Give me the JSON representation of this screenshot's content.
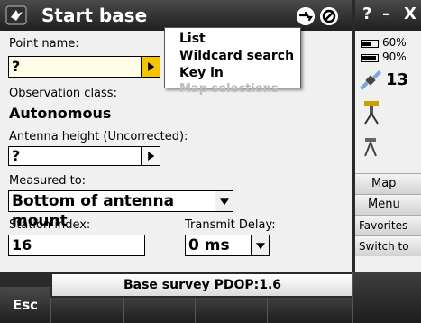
{
  "titlebar": {
    "title": "Start base"
  },
  "window_controls": {
    "help": "?",
    "minimize": "–",
    "close": "X"
  },
  "form": {
    "point_name_label": "Point name:",
    "point_name_value": "?",
    "observation_class_label": "Observation class:",
    "observation_class_value": "Autonomous",
    "antenna_height_label": "Antenna height (Uncorrected):",
    "antenna_height_value": "?",
    "measured_to_label": "Measured to:",
    "measured_to_value": "Bottom of antenna mount",
    "station_index_label": "Station index:",
    "station_index_value": "16",
    "transmit_delay_label": "Transmit Delay:",
    "transmit_delay_value": "0 ms"
  },
  "popup_menu": {
    "items": [
      "List",
      "Wildcard search",
      "Key in",
      "Map selections"
    ]
  },
  "status_panel": {
    "battery1": "60%",
    "battery2": "90%",
    "satellites": "13"
  },
  "side_buttons": [
    "Map",
    "Menu",
    "Favorites",
    "Switch to"
  ],
  "status_bar": {
    "text": "Base survey  PDOP:1.6"
  },
  "softkeys": {
    "esc": "Esc"
  }
}
